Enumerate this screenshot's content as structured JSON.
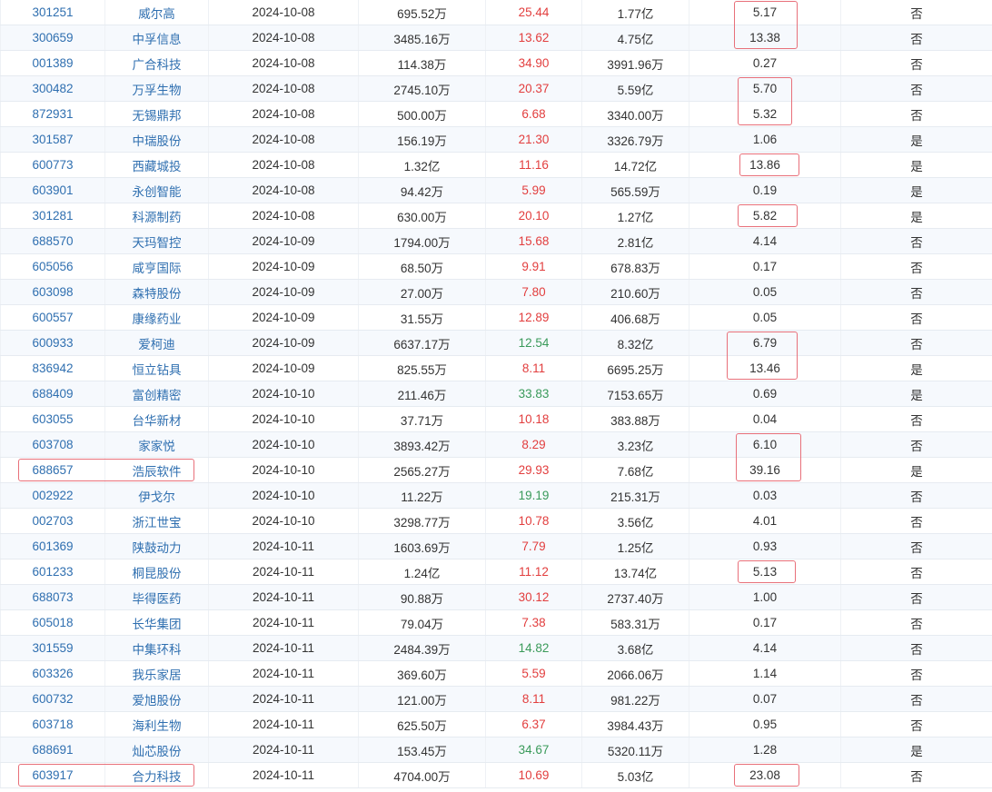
{
  "table": {
    "rows": [
      {
        "code": "301251",
        "name": "威尔高",
        "date": "2024-10-08",
        "col4": "695.52万",
        "pct": "25.44",
        "pct_dir": "up",
        "col6": "1.77亿",
        "col7": "5.17",
        "col8": "否"
      },
      {
        "code": "300659",
        "name": "中孚信息",
        "date": "2024-10-08",
        "col4": "3485.16万",
        "pct": "13.62",
        "pct_dir": "up",
        "col6": "4.75亿",
        "col7": "13.38",
        "col8": "否"
      },
      {
        "code": "001389",
        "name": "广合科技",
        "date": "2024-10-08",
        "col4": "114.38万",
        "pct": "34.90",
        "pct_dir": "up",
        "col6": "3991.96万",
        "col7": "0.27",
        "col8": "否"
      },
      {
        "code": "300482",
        "name": "万孚生物",
        "date": "2024-10-08",
        "col4": "2745.10万",
        "pct": "20.37",
        "pct_dir": "up",
        "col6": "5.59亿",
        "col7": "5.70",
        "col8": "否"
      },
      {
        "code": "872931",
        "name": "无锡鼎邦",
        "date": "2024-10-08",
        "col4": "500.00万",
        "pct": "6.68",
        "pct_dir": "up",
        "col6": "3340.00万",
        "col7": "5.32",
        "col8": "否"
      },
      {
        "code": "301587",
        "name": "中瑞股份",
        "date": "2024-10-08",
        "col4": "156.19万",
        "pct": "21.30",
        "pct_dir": "up",
        "col6": "3326.79万",
        "col7": "1.06",
        "col8": "是"
      },
      {
        "code": "600773",
        "name": "西藏城投",
        "date": "2024-10-08",
        "col4": "1.32亿",
        "pct": "11.16",
        "pct_dir": "up",
        "col6": "14.72亿",
        "col7": "13.86",
        "col8": "是"
      },
      {
        "code": "603901",
        "name": "永创智能",
        "date": "2024-10-08",
        "col4": "94.42万",
        "pct": "5.99",
        "pct_dir": "up",
        "col6": "565.59万",
        "col7": "0.19",
        "col8": "是"
      },
      {
        "code": "301281",
        "name": "科源制药",
        "date": "2024-10-08",
        "col4": "630.00万",
        "pct": "20.10",
        "pct_dir": "up",
        "col6": "1.27亿",
        "col7": "5.82",
        "col8": "是"
      },
      {
        "code": "688570",
        "name": "天玛智控",
        "date": "2024-10-09",
        "col4": "1794.00万",
        "pct": "15.68",
        "pct_dir": "up",
        "col6": "2.81亿",
        "col7": "4.14",
        "col8": "否"
      },
      {
        "code": "605056",
        "name": "咸亨国际",
        "date": "2024-10-09",
        "col4": "68.50万",
        "pct": "9.91",
        "pct_dir": "up",
        "col6": "678.83万",
        "col7": "0.17",
        "col8": "否"
      },
      {
        "code": "603098",
        "name": "森特股份",
        "date": "2024-10-09",
        "col4": "27.00万",
        "pct": "7.80",
        "pct_dir": "up",
        "col6": "210.60万",
        "col7": "0.05",
        "col8": "否"
      },
      {
        "code": "600557",
        "name": "康缘药业",
        "date": "2024-10-09",
        "col4": "31.55万",
        "pct": "12.89",
        "pct_dir": "up",
        "col6": "406.68万",
        "col7": "0.05",
        "col8": "否"
      },
      {
        "code": "600933",
        "name": "爱柯迪",
        "date": "2024-10-09",
        "col4": "6637.17万",
        "pct": "12.54",
        "pct_dir": "down",
        "col6": "8.32亿",
        "col7": "6.79",
        "col8": "否"
      },
      {
        "code": "836942",
        "name": "恒立钻具",
        "date": "2024-10-09",
        "col4": "825.55万",
        "pct": "8.11",
        "pct_dir": "up",
        "col6": "6695.25万",
        "col7": "13.46",
        "col8": "是"
      },
      {
        "code": "688409",
        "name": "富创精密",
        "date": "2024-10-10",
        "col4": "211.46万",
        "pct": "33.83",
        "pct_dir": "down",
        "col6": "7153.65万",
        "col7": "0.69",
        "col8": "是"
      },
      {
        "code": "603055",
        "name": "台华新材",
        "date": "2024-10-10",
        "col4": "37.71万",
        "pct": "10.18",
        "pct_dir": "up",
        "col6": "383.88万",
        "col7": "0.04",
        "col8": "否"
      },
      {
        "code": "603708",
        "name": "家家悦",
        "date": "2024-10-10",
        "col4": "3893.42万",
        "pct": "8.29",
        "pct_dir": "up",
        "col6": "3.23亿",
        "col7": "6.10",
        "col8": "否"
      },
      {
        "code": "688657",
        "name": "浩辰软件",
        "date": "2024-10-10",
        "col4": "2565.27万",
        "pct": "29.93",
        "pct_dir": "up",
        "col6": "7.68亿",
        "col7": "39.16",
        "col8": "是"
      },
      {
        "code": "002922",
        "name": "伊戈尔",
        "date": "2024-10-10",
        "col4": "11.22万",
        "pct": "19.19",
        "pct_dir": "down",
        "col6": "215.31万",
        "col7": "0.03",
        "col8": "否"
      },
      {
        "code": "002703",
        "name": "浙江世宝",
        "date": "2024-10-10",
        "col4": "3298.77万",
        "pct": "10.78",
        "pct_dir": "up",
        "col6": "3.56亿",
        "col7": "4.01",
        "col8": "否"
      },
      {
        "code": "601369",
        "name": "陕鼓动力",
        "date": "2024-10-11",
        "col4": "1603.69万",
        "pct": "7.79",
        "pct_dir": "up",
        "col6": "1.25亿",
        "col7": "0.93",
        "col8": "否"
      },
      {
        "code": "601233",
        "name": "桐昆股份",
        "date": "2024-10-11",
        "col4": "1.24亿",
        "pct": "11.12",
        "pct_dir": "up",
        "col6": "13.74亿",
        "col7": "5.13",
        "col8": "否"
      },
      {
        "code": "688073",
        "name": "毕得医药",
        "date": "2024-10-11",
        "col4": "90.88万",
        "pct": "30.12",
        "pct_dir": "up",
        "col6": "2737.40万",
        "col7": "1.00",
        "col8": "否"
      },
      {
        "code": "605018",
        "name": "长华集团",
        "date": "2024-10-11",
        "col4": "79.04万",
        "pct": "7.38",
        "pct_dir": "up",
        "col6": "583.31万",
        "col7": "0.17",
        "col8": "否"
      },
      {
        "code": "301559",
        "name": "中集环科",
        "date": "2024-10-11",
        "col4": "2484.39万",
        "pct": "14.82",
        "pct_dir": "down",
        "col6": "3.68亿",
        "col7": "4.14",
        "col8": "否"
      },
      {
        "code": "603326",
        "name": "我乐家居",
        "date": "2024-10-11",
        "col4": "369.60万",
        "pct": "5.59",
        "pct_dir": "up",
        "col6": "2066.06万",
        "col7": "1.14",
        "col8": "否"
      },
      {
        "code": "600732",
        "name": "爱旭股份",
        "date": "2024-10-11",
        "col4": "121.00万",
        "pct": "8.11",
        "pct_dir": "up",
        "col6": "981.22万",
        "col7": "0.07",
        "col8": "否"
      },
      {
        "code": "603718",
        "name": "海利生物",
        "date": "2024-10-11",
        "col4": "625.50万",
        "pct": "6.37",
        "pct_dir": "up",
        "col6": "3984.43万",
        "col7": "0.95",
        "col8": "否"
      },
      {
        "code": "688691",
        "name": "灿芯股份",
        "date": "2024-10-11",
        "col4": "153.45万",
        "pct": "34.67",
        "pct_dir": "down",
        "col6": "5320.11万",
        "col7": "1.28",
        "col8": "是"
      },
      {
        "code": "603917",
        "name": "合力科技",
        "date": "2024-10-11",
        "col4": "4704.00万",
        "pct": "10.69",
        "pct_dir": "up",
        "col6": "5.03亿",
        "col7": "23.08",
        "col8": "否"
      }
    ]
  },
  "colors": {
    "link": "#2f6fb0",
    "up": "#e23e3e",
    "down": "#3a9a5a",
    "highlight": "#e8707a"
  }
}
